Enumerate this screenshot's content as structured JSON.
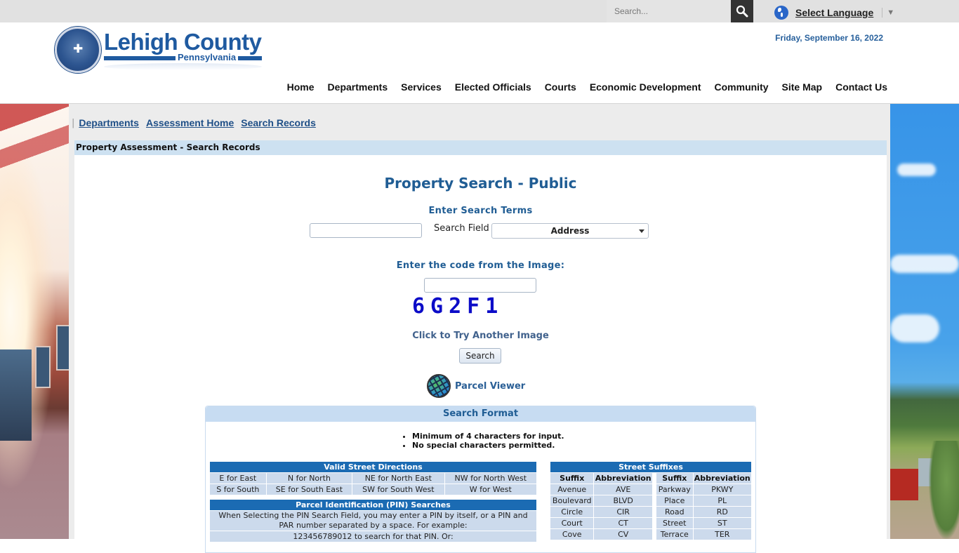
{
  "topbar": {
    "search_placeholder": "Search...",
    "language_label": "Select Language",
    "language_arrow": "▼"
  },
  "header": {
    "logo_title": "Lehigh County",
    "logo_subtitle": "Pennsylvania",
    "date": "Friday, September 16, 2022",
    "nav": [
      "Home",
      "Departments",
      "Services",
      "Elected Officials",
      "Courts",
      "Economic Development",
      "Community",
      "Site Map",
      "Contact Us"
    ]
  },
  "breadcrumb": {
    "separator": "|",
    "items": [
      "Departments",
      "Assessment Home",
      "Search Records"
    ]
  },
  "page_header": "Property Assessment - Search Records",
  "search": {
    "title": "Property Search - Public",
    "terms_label": "Enter Search Terms",
    "terms_value": "",
    "field_label": "Search Field",
    "field_selected": "Address",
    "code_label": "Enter the code from the Image:",
    "code_value": "",
    "captcha_text": "6G2F1",
    "retry_label": "Click to Try Another Image",
    "search_button": "Search",
    "parcel_viewer_label": "Parcel Viewer"
  },
  "format": {
    "title": "Search Format",
    "rules": [
      "Minimum of 4 characters for input.",
      "No special characters permitted."
    ],
    "directions": {
      "title": "Valid Street Directions",
      "rows": [
        [
          "E for East",
          "N for North",
          "NE for North East",
          "NW for North West"
        ],
        [
          "S for South",
          "SE for South East",
          "SW for South West",
          "W for West"
        ]
      ]
    },
    "pin": {
      "title": "Parcel Identification (PIN) Searches",
      "lines": [
        "When Selecting the PIN Search Field, you may enter a PIN by itself, or a PIN and PAR number separated by a space. For example:",
        "123456789012 to search for that PIN. Or:"
      ]
    },
    "suffixes": {
      "title": "Street Suffixes",
      "headers": [
        "Suffix",
        "Abbreviation",
        "Suffix",
        "Abbreviation"
      ],
      "rows": [
        [
          "Avenue",
          "AVE",
          "Parkway",
          "PKWY"
        ],
        [
          "Boulevard",
          "BLVD",
          "Place",
          "PL"
        ],
        [
          "Circle",
          "CIR",
          "Road",
          "RD"
        ],
        [
          "Court",
          "CT",
          "Street",
          "ST"
        ],
        [
          "Cove",
          "CV",
          "Terrace",
          "TER"
        ]
      ]
    }
  }
}
